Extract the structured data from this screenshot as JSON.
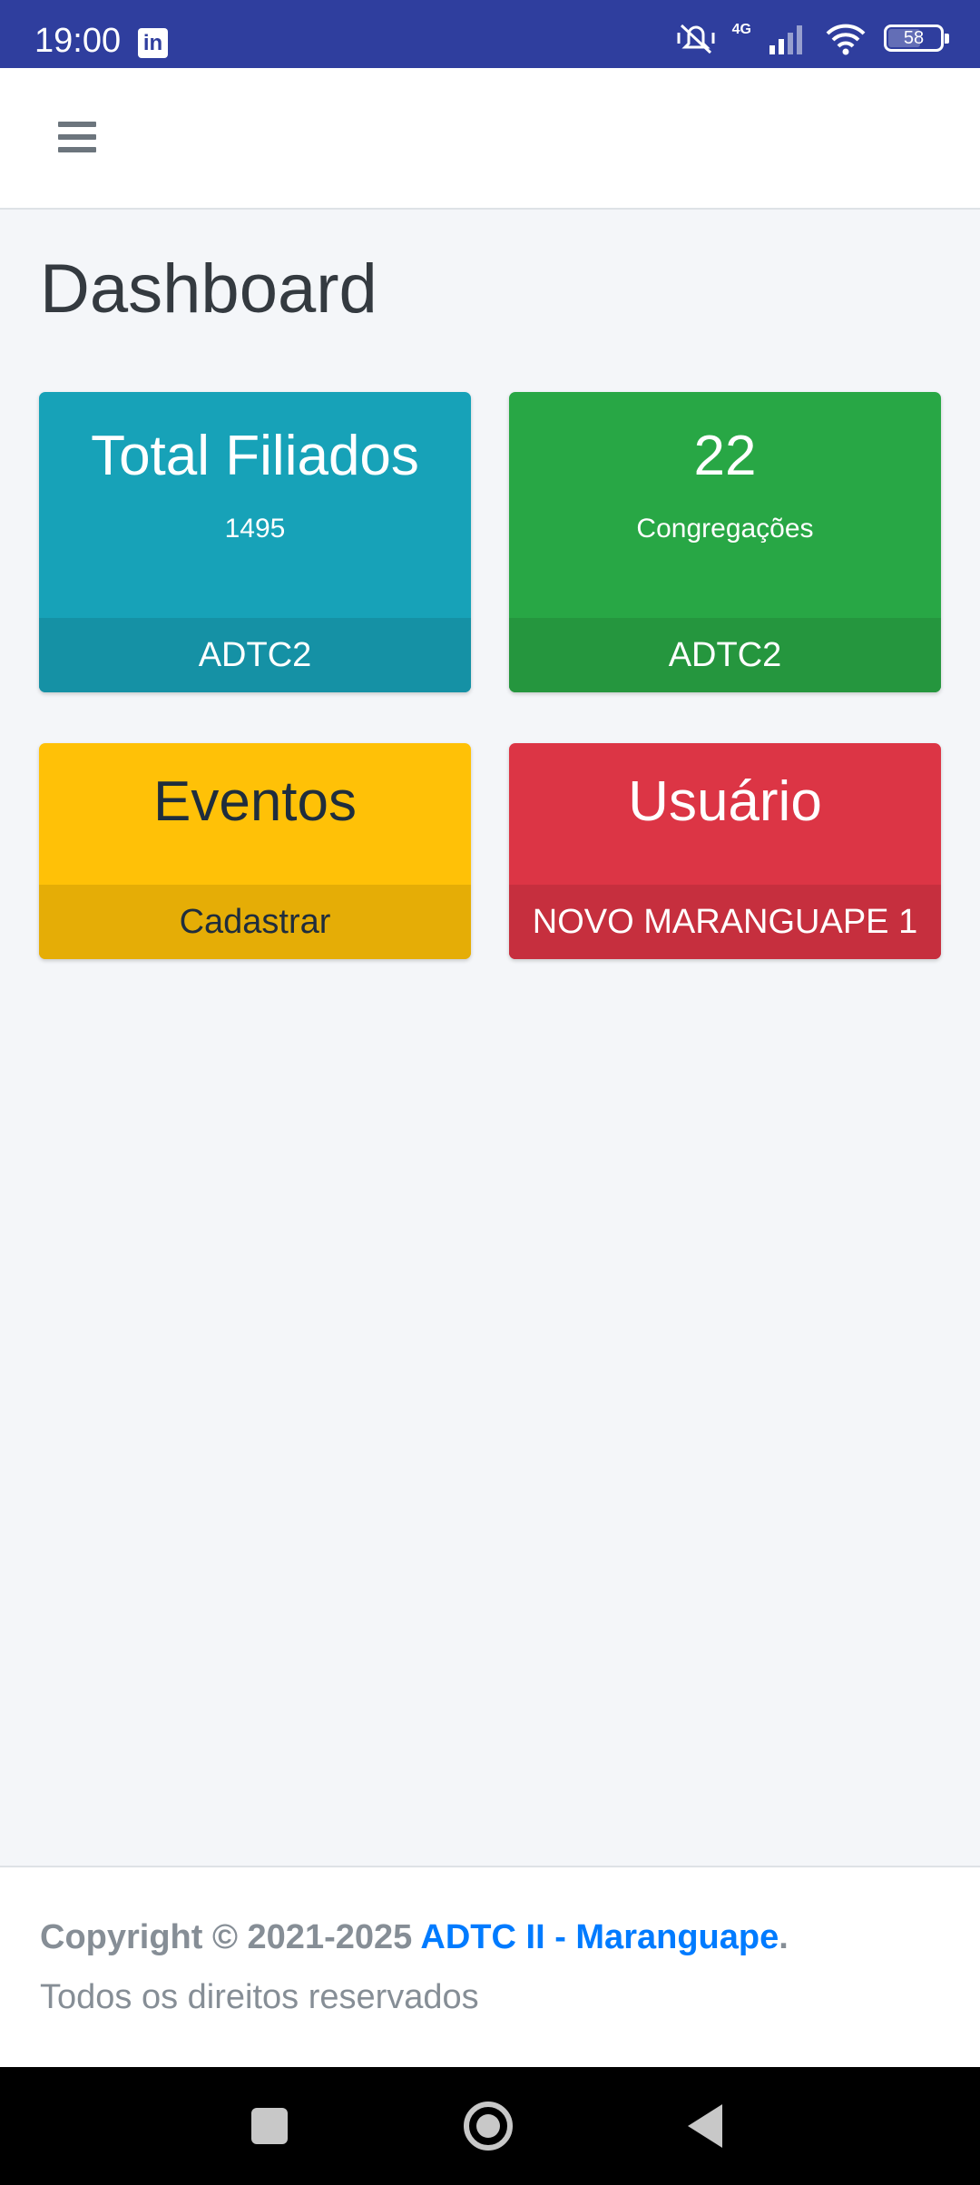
{
  "status_bar": {
    "time": "19:00",
    "notification_icon": "linkedin-icon",
    "network": "4G",
    "battery": "58",
    "battery_level": 0.58
  },
  "navbar": {
    "menu_icon": "hamburger-menu-icon"
  },
  "page": {
    "title": "Dashboard"
  },
  "cards": [
    {
      "title": "Total Filiados",
      "subtitle": "1495",
      "footer": "ADTC2",
      "color": "#17a2b8"
    },
    {
      "title": "22",
      "subtitle": "Congregações",
      "footer": "ADTC2",
      "color": "#28a745"
    },
    {
      "title": "Eventos",
      "footer": "Cadastrar",
      "color": "#ffc107"
    },
    {
      "title": "Usuário",
      "footer": "NOVO MARANGUAPE 1",
      "color": "#dc3545"
    }
  ],
  "footer": {
    "copyright_prefix": "Copyright © 2021-2025 ",
    "org_link": "ADTC II - Maranguape",
    "copyright_suffix": ".",
    "rights": "Todos os direitos reservados"
  },
  "system_nav": {
    "recents": "square-icon",
    "home": "circle-icon",
    "back": "triangle-back-icon"
  }
}
